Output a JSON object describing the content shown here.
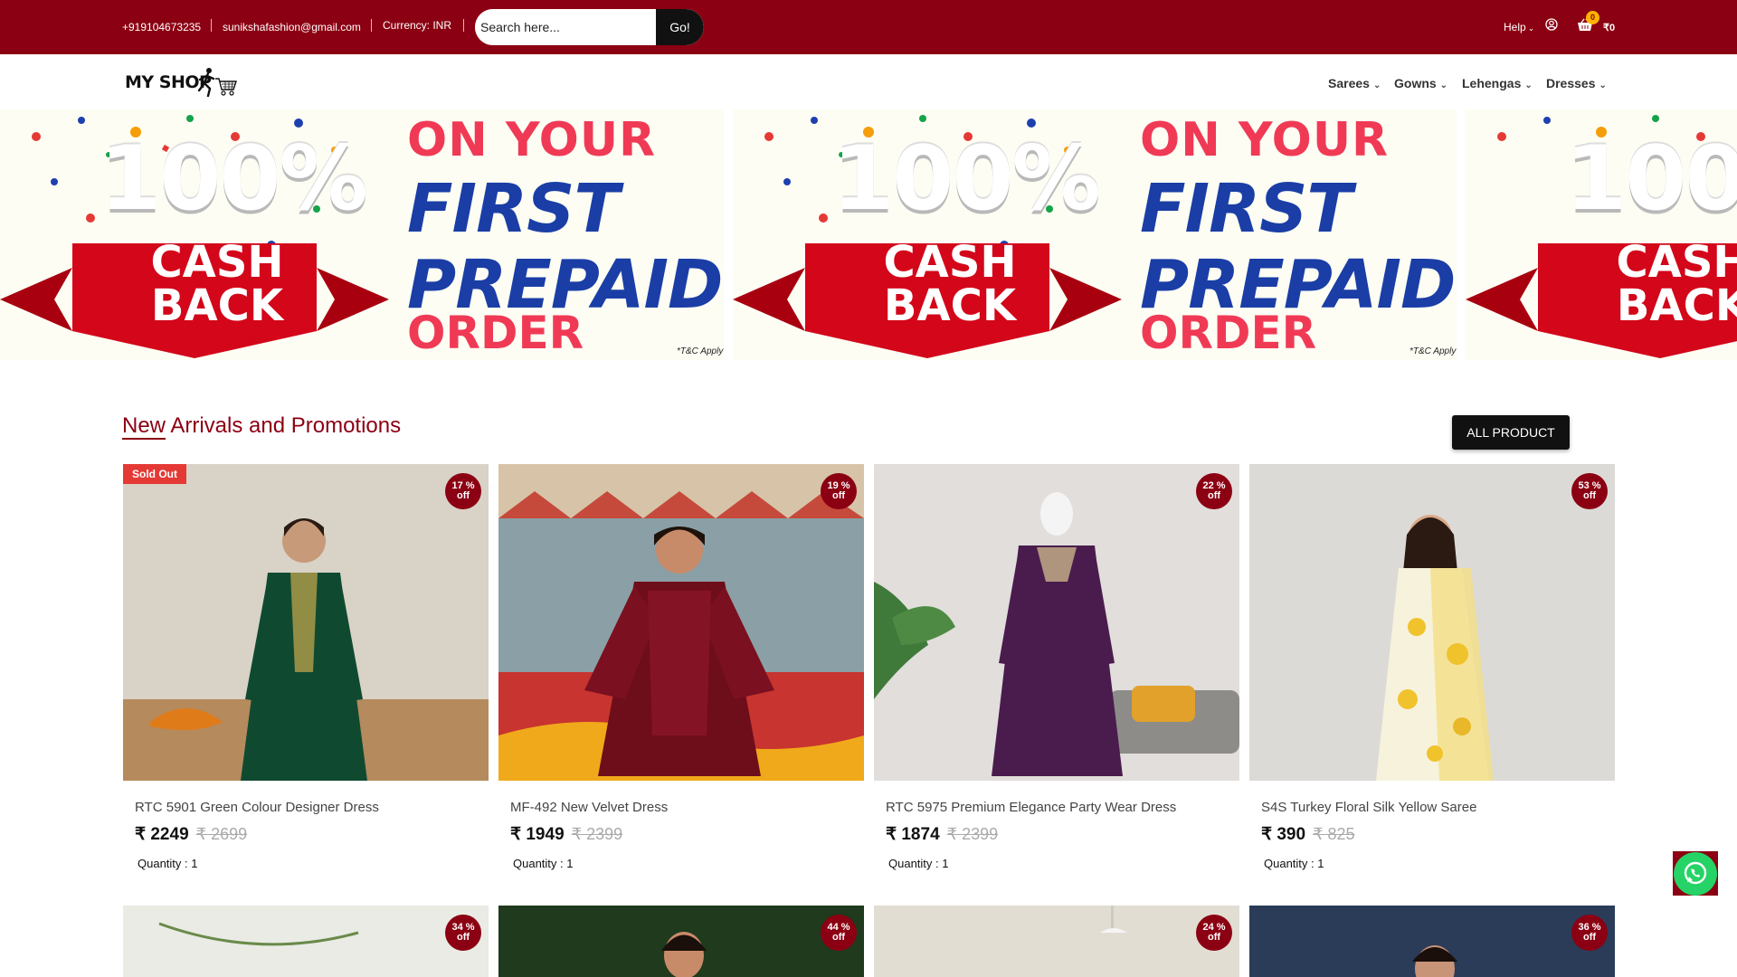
{
  "topbar": {
    "phone": "+919104673235",
    "email": "sunikshafashion@gmail.com",
    "currency": "Currency: INR",
    "search_placeholder": "Search here...",
    "search_button": "Go!",
    "help": "Help",
    "cart_count": "0",
    "cart_total": "₹0"
  },
  "nav": {
    "logo_text": "MY SHOP",
    "menu": [
      "Sarees",
      "Gowns",
      "Lehengas",
      "Dresses"
    ]
  },
  "banner": {
    "percent": "100%",
    "cashback_line1": "CASH",
    "cashback_line2": "BACK",
    "on_your": "ON YOUR",
    "first": "FIRST",
    "prepaid": "PREPAID",
    "order": "ORDER",
    "terms": "*T&C Apply"
  },
  "section": {
    "title_first": "New",
    "title_rest": " Arrivals and Promotions",
    "all_button": "ALL PRODUCT"
  },
  "products": [
    {
      "name": "RTC 5901 Green Colour Designer Dress",
      "price": "₹ 2249",
      "mrp": "₹ 2699",
      "discount": "17 % off",
      "qty": "Quantity : 1",
      "sold_out": "Sold Out"
    },
    {
      "name": "MF-492 New Velvet Dress",
      "price": "₹ 1949",
      "mrp": "₹ 2399",
      "discount": "19 % off",
      "qty": "Quantity : 1"
    },
    {
      "name": "RTC 5975 Premium Elegance Party Wear Dress",
      "price": "₹ 1874",
      "mrp": "₹ 2399",
      "discount": "22 % off",
      "qty": "Quantity : 1"
    },
    {
      "name": "S4S Turkey Floral Silk Yellow Saree",
      "price": "₹ 390",
      "mrp": "₹ 825",
      "discount": "53 % off",
      "qty": "Quantity : 1"
    }
  ],
  "next_row_discounts": [
    "34 % off",
    "44 % off",
    "24 % off",
    "36 % off"
  ],
  "colors": {
    "brand": "#8b0012",
    "badge": "#8b0012",
    "sold_out": "#e53935",
    "whatsapp": "#25d366"
  }
}
